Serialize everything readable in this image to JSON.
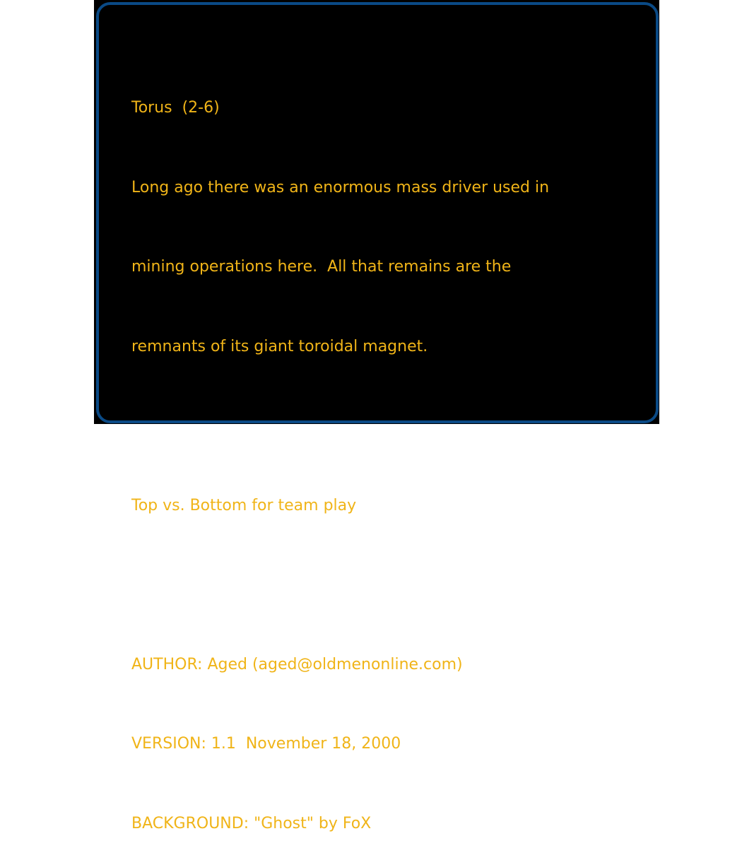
{
  "map_info": {
    "title": "Torus  (2-6)",
    "description_lines": [
      "Long ago there was an enormous mass driver used in",
      "mining operations here.  All that remains are the",
      "remnants of its giant toroidal magnet."
    ],
    "team_note": "Top vs. Bottom for team play",
    "author": "AUTHOR: Aged (aged@oldmenonline.com)",
    "version": "VERSION: 1.1  November 18, 2000",
    "background": "BACKGROUND: \"Ghost\" by FoX"
  },
  "colors": {
    "text": "#f0b418",
    "border": "#0a4a86",
    "panel_bg": "#000000"
  }
}
